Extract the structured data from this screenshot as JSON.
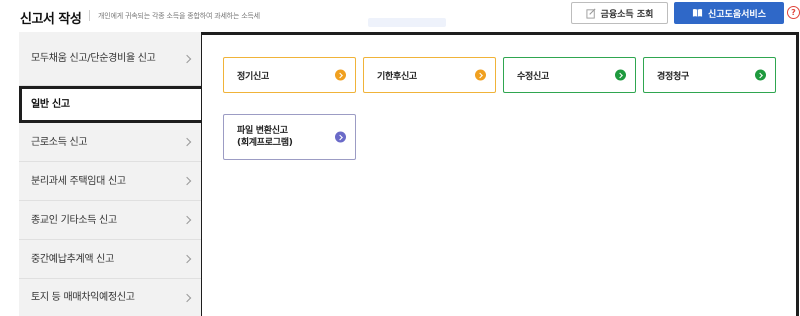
{
  "header": {
    "title": "신고서 작성",
    "description": "개인에게 귀속되는 각종 소득을 종합하여 과세하는 소득세",
    "financial_income_button": "금융소득 조회",
    "help_service_button": "신고도움서비스",
    "help_icon_glyph": "?"
  },
  "sidebar": {
    "items": [
      {
        "label": "모두채움 신고/단순경비율 신고"
      },
      {
        "label": "일반 신고"
      },
      {
        "label": "근로소득 신고"
      },
      {
        "label": "분리과세 주택임대 신고"
      },
      {
        "label": "종교인 기타소득 신고"
      },
      {
        "label": "중간예납추계액 신고"
      },
      {
        "label": "토지 등 매매차익예정신고"
      }
    ]
  },
  "cards": [
    {
      "label": "정기신고",
      "icon": "arrow-circle-icon",
      "color": "#f0a020"
    },
    {
      "label": "기한후신고",
      "icon": "arrow-circle-icon",
      "color": "#f0a020"
    },
    {
      "label": "수정신고",
      "icon": "arrow-circle-icon",
      "color": "#1e9a3e"
    },
    {
      "label": "경정청구",
      "icon": "arrow-circle-icon",
      "color": "#1e9a3e"
    },
    {
      "label": "파일 변환신고\n(회계프로그램)",
      "icon": "arrow-circle-icon",
      "color": "#6a6ac8"
    }
  ],
  "colors": {
    "primary": "#2f68c8",
    "orange": "#f0a020",
    "green": "#1e9a3e",
    "purple": "#6a6ac8",
    "alert": "#e0463c"
  }
}
